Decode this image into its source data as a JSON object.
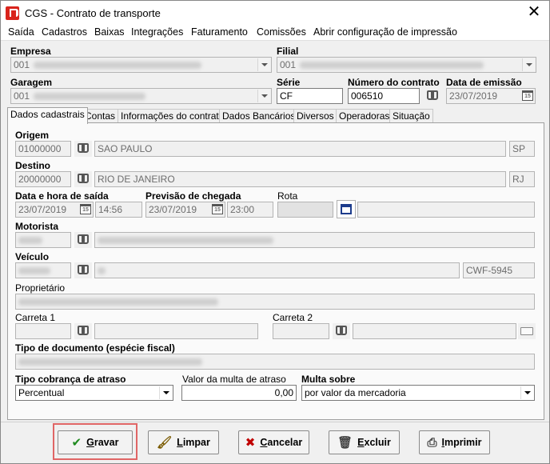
{
  "window": {
    "title": "CGS - Contrato de transporte",
    "close_glyph": "✕"
  },
  "menu": [
    "Saída",
    "Cadastros",
    "Baixas",
    "Integrações",
    "Faturamento",
    "Comissões",
    "Abrir configuração de impressão"
  ],
  "header": {
    "empresa_label": "Empresa",
    "empresa_code": "001",
    "filial_label": "Filial",
    "filial_code": "001",
    "garagem_label": "Garagem",
    "garagem_code": "001",
    "serie_label": "Série",
    "serie_value": "CF",
    "numero_label": "Número do contrato",
    "numero_value": "006510",
    "emissao_label": "Data de emissão",
    "emissao_value": "23/07/2019"
  },
  "tabs": [
    "Dados cadastrais",
    "Contas",
    "Informações do contrato",
    "Dados Bancários",
    "Diversos",
    "Operadoras",
    "Situação"
  ],
  "form": {
    "origem_label": "Origem",
    "origem_code": "01000000",
    "origem_city": "SAO PAULO",
    "origem_uf": "SP",
    "destino_label": "Destino",
    "destino_code": "20000000",
    "destino_city": "RIO DE JANEIRO",
    "destino_uf": "RJ",
    "saida_label": "Data e hora de saída",
    "saida_date": "23/07/2019",
    "saida_time": "14:56",
    "chegada_label": "Previsão de chegada",
    "chegada_date": "23/07/2019",
    "chegada_time": "23:00",
    "rota_label": "Rota",
    "motorista_label": "Motorista",
    "veiculo_label": "Veículo",
    "veiculo_placa": "CWF-5945",
    "proprietario_label": "Proprietário",
    "carreta1_label": "Carreta 1",
    "carreta2_label": "Carreta 2",
    "tipo_doc_label": "Tipo de documento (espécie fiscal)",
    "cobranca_label": "Tipo cobrança de atraso",
    "cobranca_value": "Percentual",
    "multa_label": "Valor da multa de atraso",
    "multa_value": "0,00",
    "multa_sobre_label": "Multa sobre",
    "multa_sobre_value": "por valor da mercadoria"
  },
  "buttons": {
    "gravar_first": "G",
    "gravar_rest": "ravar",
    "limpar_first": "L",
    "limpar_rest": "impar",
    "cancelar_first": "C",
    "cancelar_rest": "ancelar",
    "excluir_first": "E",
    "excluir_rest": "xcluir",
    "imprimir_first": "I",
    "imprimir_rest": "mprimir"
  },
  "calendar_glyph": "15",
  "colors": {
    "gravar_check": "#1f8a1f",
    "cancelar_x": "#c00000",
    "focus_ring": "#e06666"
  }
}
